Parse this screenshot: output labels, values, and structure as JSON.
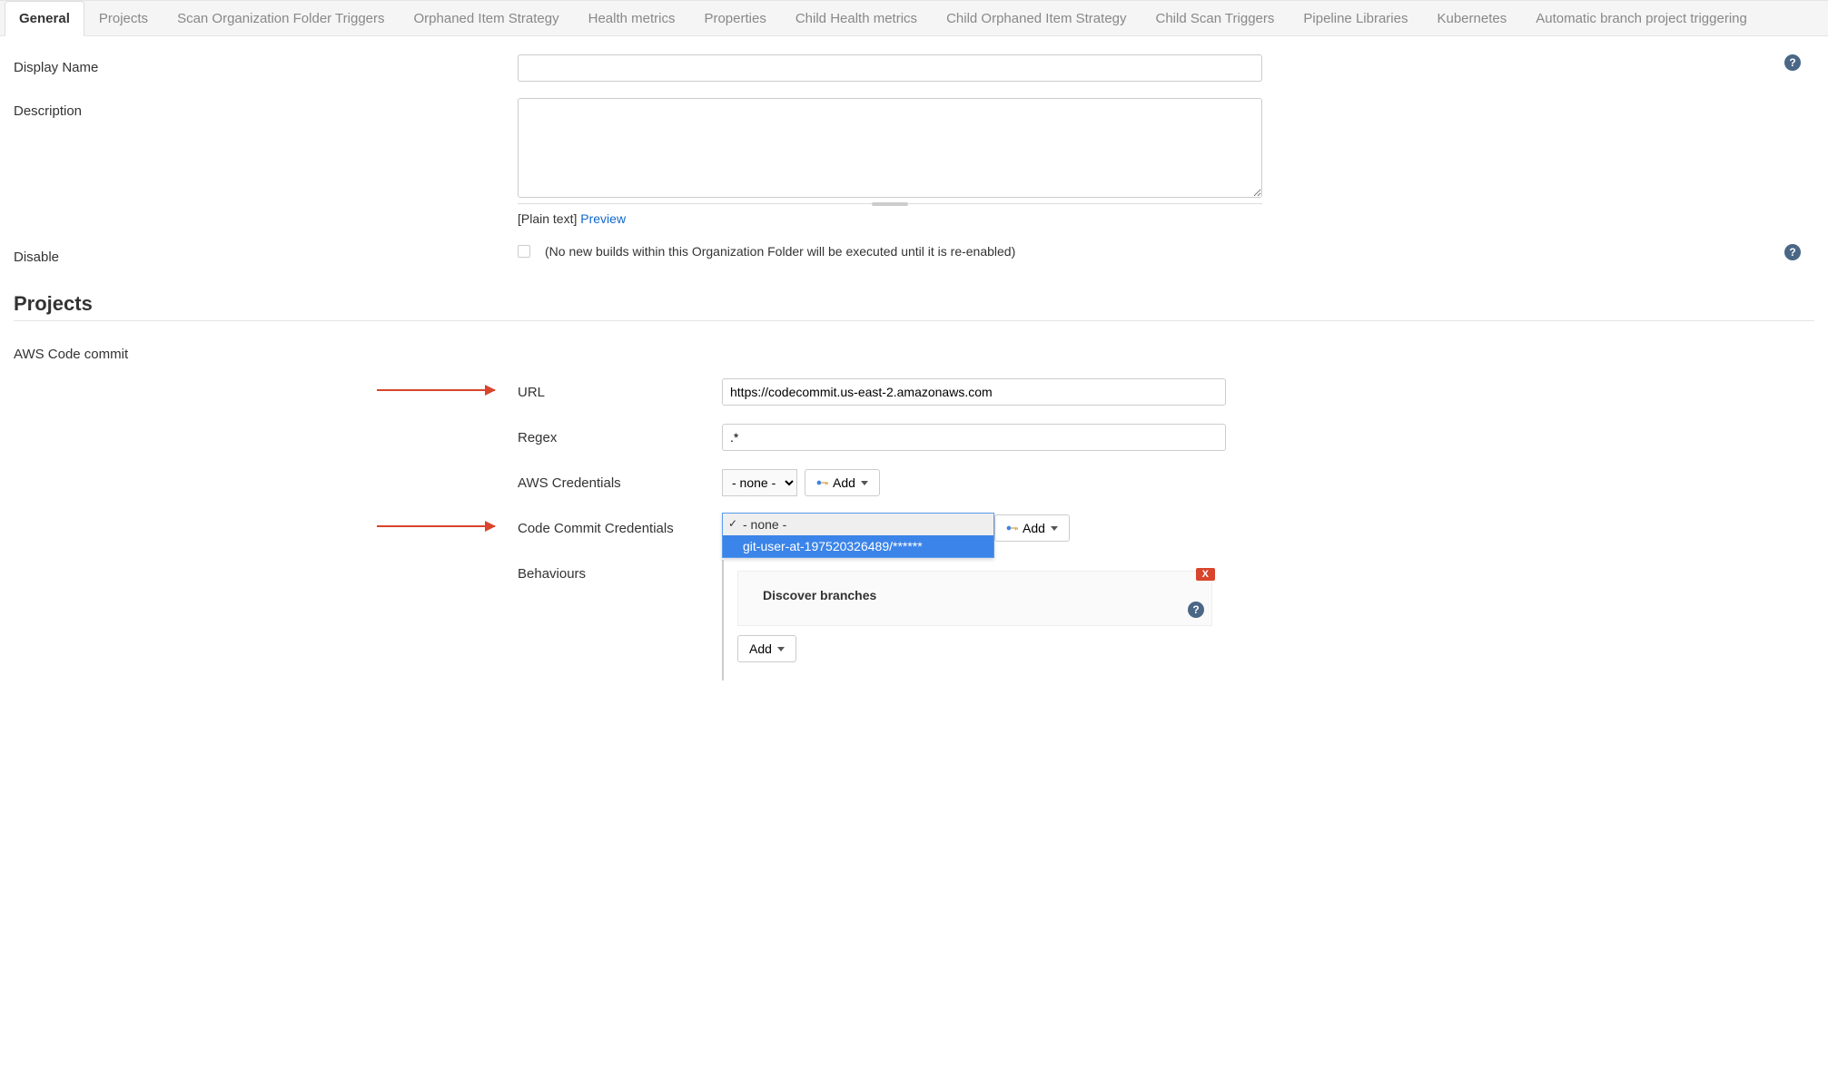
{
  "tabs": {
    "general": "General",
    "projects": "Projects",
    "scan_triggers": "Scan Organization Folder Triggers",
    "orphaned": "Orphaned Item Strategy",
    "health": "Health metrics",
    "properties": "Properties",
    "child_health": "Child Health metrics",
    "child_orphaned": "Child Orphaned Item Strategy",
    "child_scan": "Child Scan Triggers",
    "pipeline_libs": "Pipeline Libraries",
    "k8s": "Kubernetes",
    "auto_branch": "Automatic branch project triggering"
  },
  "general": {
    "display_name_label": "Display Name",
    "display_name_value": "",
    "description_label": "Description",
    "description_value": "",
    "plain_text": "[Plain text]",
    "preview": "Preview",
    "disable_label": "Disable",
    "disable_hint": "(No new builds within this Organization Folder will be executed until it is re-enabled)"
  },
  "sections": {
    "projects": "Projects"
  },
  "projects": {
    "source_label": "AWS Code commit",
    "url_label": "URL",
    "url_value": "https://codecommit.us-east-2.amazonaws.com",
    "regex_label": "Regex",
    "regex_value": ".*",
    "aws_cred_label": "AWS Credentials",
    "aws_cred_value": "- none -",
    "cc_cred_label": "Code Commit Credentials",
    "cc_dropdown_none": "- none -",
    "cc_dropdown_user": "git-user-at-197520326489/******",
    "behaviours_label": "Behaviours",
    "discover_branches": "Discover branches",
    "add_button": "Add",
    "delete_x": "X"
  }
}
